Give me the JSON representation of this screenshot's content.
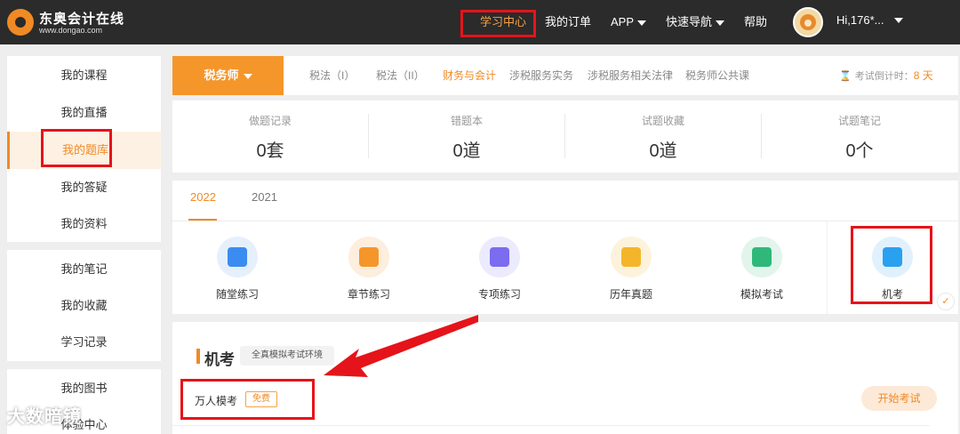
{
  "brand": {
    "name": "东奥会计在线",
    "url": "www.dongao.com",
    "accent": "#f08a24"
  },
  "nav": {
    "items": [
      {
        "label": "学习中心",
        "active": true
      },
      {
        "label": "我的订单"
      },
      {
        "label": "APP"
      },
      {
        "label": "快速导航"
      },
      {
        "label": "帮助"
      }
    ],
    "user": "Hi,176*..."
  },
  "sidebar": {
    "groups": [
      [
        "我的课程",
        "我的直播",
        "我的题库",
        "我的答疑",
        "我的资料"
      ],
      [
        "我的笔记",
        "我的收藏",
        "学习记录"
      ],
      [
        "我的图书",
        "体验中心"
      ]
    ],
    "active": "我的题库"
  },
  "subject": {
    "current": "税务师",
    "tabs": [
      "税法（I）",
      "税法（II）",
      "财务与会计",
      "涉税服务实务",
      "涉税服务相关法律",
      "税务师公共课"
    ],
    "active_tab": "财务与会计",
    "countdown_label": "考试倒计时：",
    "countdown_days": "8 天"
  },
  "stats": [
    {
      "label": "做题记录",
      "value": "0套"
    },
    {
      "label": "错题本",
      "value": "0道"
    },
    {
      "label": "试题收藏",
      "value": "0道"
    },
    {
      "label": "试题笔记",
      "value": "0个"
    }
  ],
  "years": [
    "2022",
    "2021"
  ],
  "active_year": "2022",
  "practice": [
    {
      "label": "随堂练习",
      "icon": "video-icon",
      "color": "#3b8cf0"
    },
    {
      "label": "章节练习",
      "icon": "book-icon",
      "color": "#f5962a"
    },
    {
      "label": "专项练习",
      "icon": "checklist-icon",
      "color": "#7b6cf0"
    },
    {
      "label": "历年真题",
      "icon": "star-bookmark-icon",
      "color": "#f5b52a"
    },
    {
      "label": "模拟考试",
      "icon": "exam-paper-icon",
      "color": "#2fb87a"
    },
    {
      "label": "机考",
      "icon": "monitor-icon",
      "color": "#2aa0f0",
      "selected": true
    }
  ],
  "section": {
    "title": "机考",
    "tag": "全真模拟考试环境",
    "exam_name": "万人模考",
    "free_badge": "免费",
    "start_button": "开始考试"
  },
  "watermark": "大数暗镜"
}
